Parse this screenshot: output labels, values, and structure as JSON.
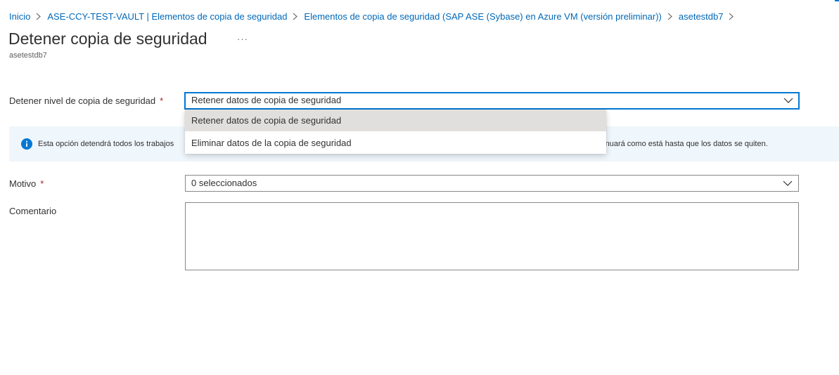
{
  "breadcrumb": [
    {
      "label": "Inicio"
    },
    {
      "label": "ASE-CCY-TEST-VAULT | Elementos de copia de seguridad"
    },
    {
      "label": "Elementos de copia de seguridad (SAP ASE (Sybase) en Azure VM (versión preliminar))"
    },
    {
      "label": "asetestdb7"
    }
  ],
  "page": {
    "title": "Detener copia de seguridad",
    "more_label": "···",
    "subtitle": "asetestdb7"
  },
  "stop_level": {
    "label": "Detener nivel de copia de seguridad",
    "required_mark": "*",
    "selected": "Retener datos de copia de seguridad",
    "options": [
      {
        "label": "Retener datos de copia de seguridad",
        "selected": true
      },
      {
        "label": "Eliminar datos de la copia de seguridad",
        "selected": false
      }
    ]
  },
  "info": {
    "icon": "info-icon",
    "text_visible_left": "Esta opción detendrá todos los trabajos",
    "text_visible_right": "ntinuará como está hasta que los datos se quiten."
  },
  "reason": {
    "label": "Motivo",
    "required_mark": "*",
    "value": "0 seleccionados"
  },
  "comment": {
    "label": "Comentario",
    "value": ""
  },
  "colors": {
    "accent": "#0078d4",
    "link": "#0068b8",
    "required": "#a4262c",
    "info_background": "#eff6fc",
    "menu_selected": "#e1dfdd"
  }
}
